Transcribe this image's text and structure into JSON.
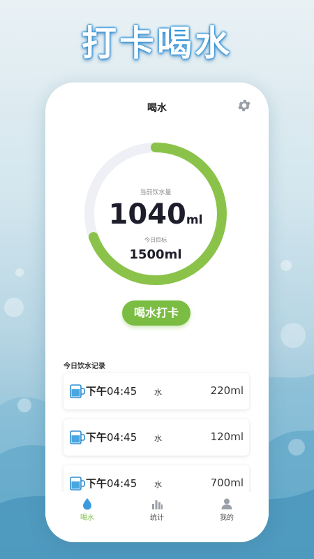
{
  "promo": {
    "title": "打卡喝水"
  },
  "header": {
    "title": "喝水",
    "settings_icon": "gear-icon"
  },
  "progress": {
    "current_label": "当前饮水量",
    "current_value": "1040",
    "current_unit": "ml",
    "target_label": "今日目标",
    "target_value": "1500ml",
    "fraction": 0.693,
    "ring_color": "#8bc34a",
    "track_color": "#eef0f5"
  },
  "checkin_button": {
    "label": "喝水打卡",
    "color": "#7bbd43"
  },
  "records": {
    "title": "今日饮水记录",
    "items": [
      {
        "period": "下午",
        "time": "04:45",
        "type": "水",
        "amount": "220ml",
        "icon": "cup-icon"
      },
      {
        "period": "下午",
        "time": "04:45",
        "type": "水",
        "amount": "120ml",
        "icon": "cup-icon"
      },
      {
        "period": "下午",
        "time": "04:45",
        "type": "水",
        "amount": "700ml",
        "icon": "cup-icon"
      }
    ]
  },
  "tabbar": {
    "active_color": "#7bbd43",
    "items": [
      {
        "label": "喝水",
        "icon": "water-drop-icon",
        "active": true
      },
      {
        "label": "统计",
        "icon": "bar-chart-icon",
        "active": false
      },
      {
        "label": "我的",
        "icon": "user-icon",
        "active": false
      }
    ]
  }
}
